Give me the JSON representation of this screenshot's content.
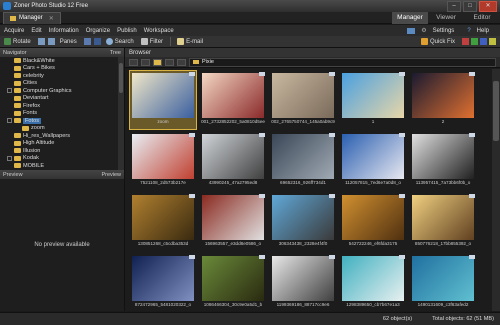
{
  "window": {
    "title": "Zoner Photo Studio 12 Free"
  },
  "tab": {
    "label": "Manager"
  },
  "modes": [
    "Manager",
    "Viewer",
    "Editor"
  ],
  "menu": [
    "Acquire",
    "Edit",
    "Information",
    "Organize",
    "Publish",
    "Workspace"
  ],
  "menu_right": {
    "settings": "Settings",
    "help": "Help"
  },
  "toolbar": {
    "rotate": "Rotate",
    "panes": "Panes",
    "search": "Search",
    "filter": "Filter",
    "email": "E-mail",
    "quickfix": "Quick Fix"
  },
  "navigator": {
    "title": "Navigator",
    "view": "Tree"
  },
  "tree": [
    {
      "label": "Black&White"
    },
    {
      "label": "Cars + Bikes"
    },
    {
      "label": "celebrity"
    },
    {
      "label": "Cities"
    },
    {
      "label": "Computer Graphics"
    },
    {
      "label": "Deviantart"
    },
    {
      "label": "Firefox"
    },
    {
      "label": "Fonts"
    },
    {
      "label": "Fonts (zoom)",
      "display": "zoom"
    },
    {
      "label": "Hi_res_Wallpapers"
    },
    {
      "label": "High Altitude"
    },
    {
      "label": "Illusion"
    },
    {
      "label": "Kodak"
    },
    {
      "label": "MOBILE"
    }
  ],
  "tree_sel_label": "Fotos",
  "preview": {
    "title": "Preview",
    "menu": "Preview",
    "empty": "No preview available"
  },
  "browser": {
    "title": "Browser",
    "path": "Pixie"
  },
  "thumbs": [
    {
      "cap": "zoom",
      "c1": "#f0e7c8",
      "c2": "#3a5fa0"
    },
    {
      "cap": "001_2732852202_5a0810d5ee",
      "c1": "#f4d7c4",
      "c2": "#8a2a2a"
    },
    {
      "cap": "002_2765750744_145a0ab9c9",
      "c1": "#c9b8a0",
      "c2": "#7a6a5a"
    },
    {
      "cap": "1",
      "c1": "#4aa0e0",
      "c2": "#e8d6a8"
    },
    {
      "cap": "2",
      "c1": "#1a1a30",
      "c2": "#e07030"
    },
    {
      "cap": "7521108_2d573b217e",
      "c1": "#e8eef4",
      "c2": "#c04030"
    },
    {
      "cap": "43990245_47a2795ed8",
      "c1": "#d0d4d8",
      "c2": "#404040"
    },
    {
      "cap": "69652316_926ff734d1",
      "c1": "#3a4656",
      "c2": "#a0aab4"
    },
    {
      "cap": "112057815_7ed6e7a0d8_o",
      "c1": "#2a5fb0",
      "c2": "#e8e8f0"
    },
    {
      "cap": "113957415_7a73bb6f0b_o",
      "c1": "#e0e0e0",
      "c2": "#202020"
    },
    {
      "cap": "130851268_c5cdba353d",
      "c1": "#b08030",
      "c2": "#3a2a10"
    },
    {
      "cap": "156963557_e3dd8e0586_o",
      "c1": "#8a2a20",
      "c2": "#e0e0e0"
    },
    {
      "cap": "306343438_2328e4f4f0",
      "c1": "#60a8d8",
      "c2": "#3a3a3a"
    },
    {
      "cap": "542722246_ef6fda3175",
      "c1": "#d09030",
      "c2": "#503010"
    },
    {
      "cap": "850776218_17bb855392_o",
      "c1": "#f0d080",
      "c2": "#604020"
    },
    {
      "cap": "872472965_5481020322_o",
      "c1": "#102050",
      "c2": "#8090c0"
    },
    {
      "cap": "1086466304_30c9e0a5d1_b",
      "c1": "#6a8a3a",
      "c2": "#2a2a10"
    },
    {
      "cap": "1199369186_88717cc9e6",
      "c1": "#e8e8e8",
      "c2": "#404040"
    },
    {
      "cap": "1298389650_cb7b67e1a3",
      "c1": "#40b0c0",
      "c2": "#e8f0f0"
    },
    {
      "cap": "1490131609_c3f63afed2",
      "c1": "#2070a0",
      "c2": "#60c0d0"
    }
  ],
  "status": {
    "objects": "62 object(s)",
    "total": "Total objects: 62 (51 MB)"
  }
}
